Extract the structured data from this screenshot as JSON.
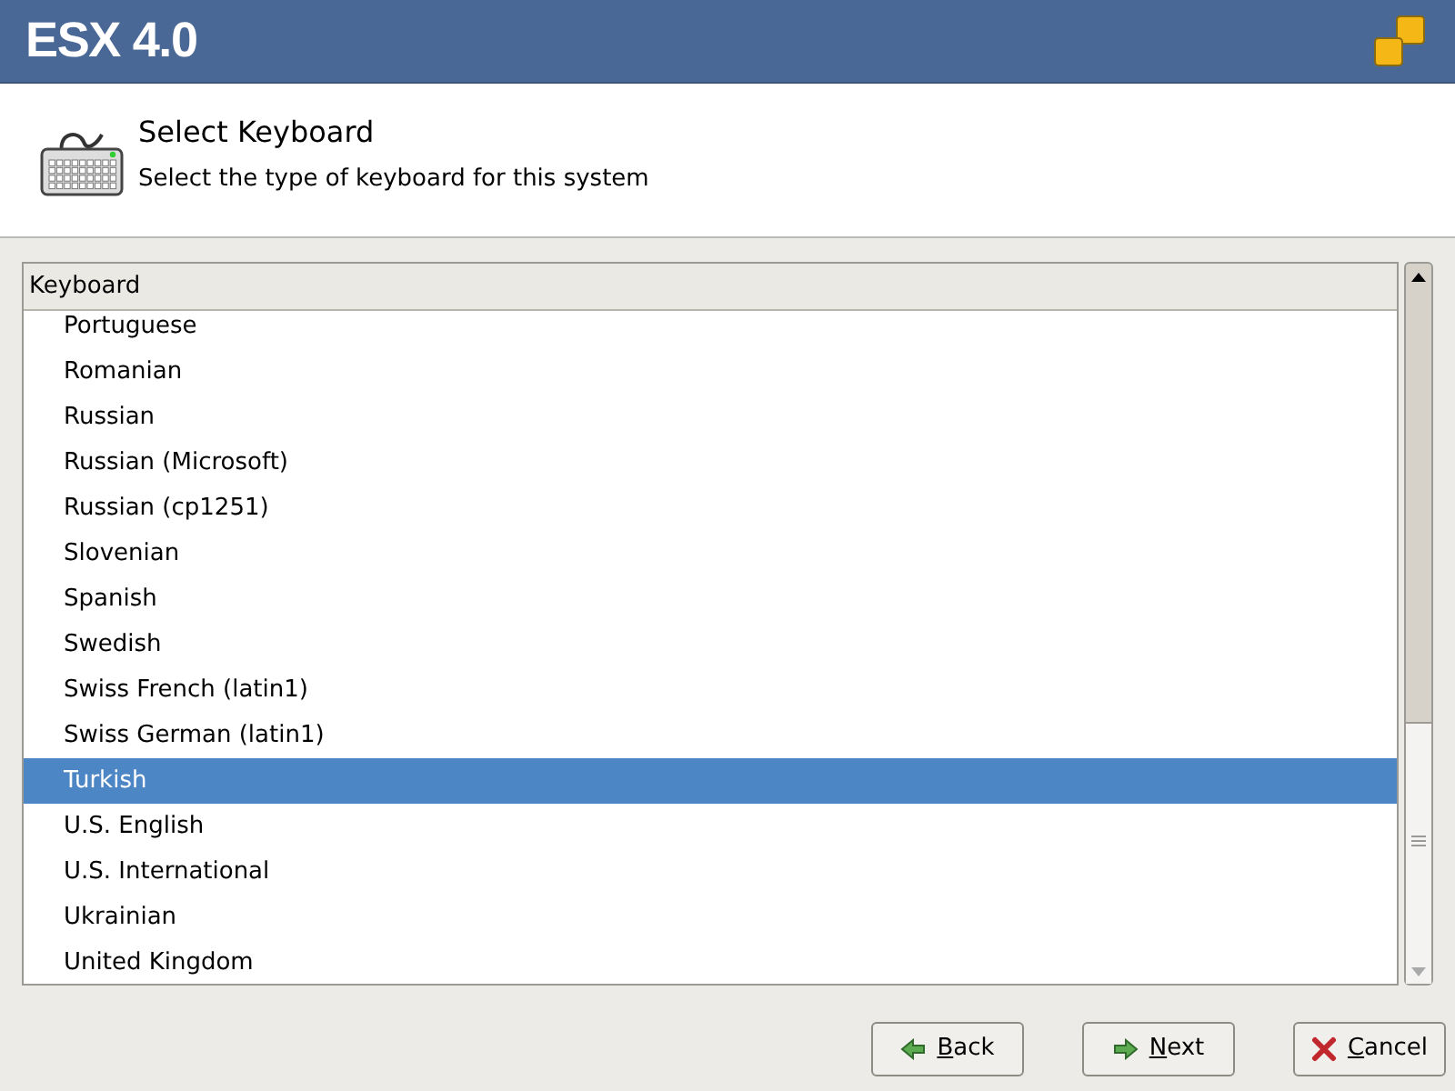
{
  "header": {
    "title": "ESX 4.0"
  },
  "page": {
    "title": "Select Keyboard",
    "subtitle": "Select the type of keyboard for this system"
  },
  "list": {
    "column": "Keyboard",
    "items": [
      {
        "label": "Portuguese",
        "selected": false
      },
      {
        "label": "Romanian",
        "selected": false
      },
      {
        "label": "Russian",
        "selected": false
      },
      {
        "label": "Russian (Microsoft)",
        "selected": false
      },
      {
        "label": "Russian (cp1251)",
        "selected": false
      },
      {
        "label": "Slovenian",
        "selected": false
      },
      {
        "label": "Spanish",
        "selected": false
      },
      {
        "label": "Swedish",
        "selected": false
      },
      {
        "label": "Swiss French (latin1)",
        "selected": false
      },
      {
        "label": "Swiss German (latin1)",
        "selected": false
      },
      {
        "label": "Turkish",
        "selected": true
      },
      {
        "label": "U.S. English",
        "selected": false
      },
      {
        "label": "U.S. International",
        "selected": false
      },
      {
        "label": "Ukrainian",
        "selected": false
      },
      {
        "label": "United Kingdom",
        "selected": false
      }
    ]
  },
  "buttons": [
    {
      "label": "Back",
      "kind": "back"
    },
    {
      "label": "Next",
      "kind": "next"
    },
    {
      "label": "Cancel",
      "kind": "cancel"
    }
  ]
}
